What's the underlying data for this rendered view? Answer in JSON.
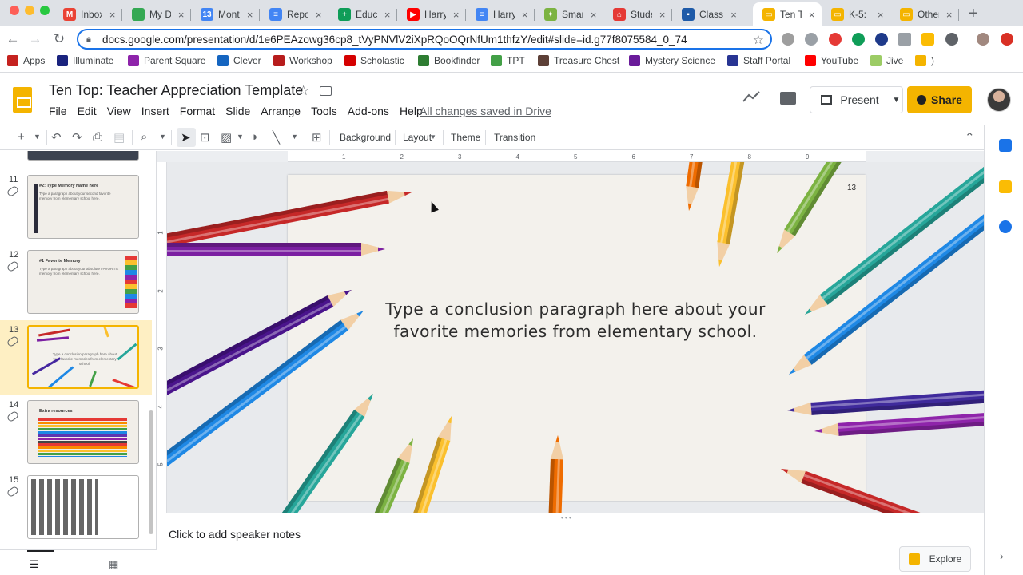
{
  "browser": {
    "tabs": [
      {
        "title": "Inbox",
        "favicon": "gmail-icon",
        "color": "#ea4335",
        "letter": "M"
      },
      {
        "title": "My Dr",
        "favicon": "drive-icon",
        "color": "#34a853",
        "letter": ""
      },
      {
        "title": "Monte",
        "favicon": "calendar-icon",
        "color": "#4285f4",
        "letter": "13"
      },
      {
        "title": "Repor",
        "favicon": "docs-icon",
        "color": "#4285f4",
        "letter": "≡"
      },
      {
        "title": "Educa",
        "favicon": "plus-icon",
        "color": "#0f9d58",
        "letter": "+"
      },
      {
        "title": "Harry",
        "favicon": "youtube-icon",
        "color": "#ff0000",
        "letter": "▶"
      },
      {
        "title": "Harry",
        "favicon": "docs-icon",
        "color": "#4285f4",
        "letter": "≡"
      },
      {
        "title": "Smar",
        "favicon": "smartboard-icon",
        "color": "#7cb342",
        "letter": "✦"
      },
      {
        "title": "Stude",
        "favicon": "home-icon",
        "color": "#e53935",
        "letter": "⌂"
      },
      {
        "title": "Class",
        "favicon": "classroom-icon",
        "color": "#1e5aa8",
        "letter": "▪"
      },
      {
        "title": "Ten T",
        "favicon": "slides-icon",
        "color": "#f4b400",
        "letter": "▭"
      },
      {
        "title": "K-5:",
        "favicon": "slides-icon",
        "color": "#f4b400",
        "letter": "▭"
      },
      {
        "title": "Other",
        "favicon": "slides-icon",
        "color": "#f4b400",
        "letter": "▭"
      }
    ],
    "active_tab_index": 10,
    "url": "docs.google.com/presentation/d/1e6PEAzowg36cp8_tVyPNVlV2iXpRQoOQrNfUm1thfzY/edit#slide=id.g77f8075584_0_74",
    "bookmarks": [
      {
        "label": "Apps",
        "icon": "apps-grid-icon",
        "color": "#c5221f"
      },
      {
        "label": "Illuminate",
        "icon": "illuminate-icon",
        "color": "#1a237e"
      },
      {
        "label": "Parent Square",
        "icon": "parentsquare-icon",
        "color": "#8e24aa"
      },
      {
        "label": "Clever",
        "icon": "clever-icon",
        "color": "#1565c0"
      },
      {
        "label": "Workshop",
        "icon": "workshop-icon",
        "color": "#b71c1c"
      },
      {
        "label": "Scholastic",
        "icon": "scholastic-icon",
        "color": "#d50000"
      },
      {
        "label": "Bookfinder",
        "icon": "bookfinder-icon",
        "color": "#2e7d32"
      },
      {
        "label": "TPT",
        "icon": "tpt-icon",
        "color": "#43a047"
      },
      {
        "label": "Treasure Chest",
        "icon": "treasure-icon",
        "color": "#5d4037"
      },
      {
        "label": "Mystery Science",
        "icon": "mystery-icon",
        "color": "#6a1b9a"
      },
      {
        "label": "Staff Portal",
        "icon": "portal-icon",
        "color": "#283593"
      },
      {
        "label": "YouTube",
        "icon": "youtube-icon",
        "color": "#ff0000"
      },
      {
        "label": "Jive",
        "icon": "jive-icon",
        "color": "#9ccc65"
      },
      {
        "label": ")",
        "icon": "slides-icon",
        "color": "#f4b400"
      }
    ]
  },
  "app": {
    "title": "Ten Top: Teacher Appreciation Template",
    "menu": [
      "File",
      "Edit",
      "View",
      "Insert",
      "Format",
      "Slide",
      "Arrange",
      "Tools",
      "Add-ons",
      "Help"
    ],
    "save_status": "All changes saved in Drive",
    "present_label": "Present",
    "share_label": "Share",
    "accent": "#f4b400"
  },
  "toolbar": {
    "background": "Background",
    "layout": "Layout",
    "theme": "Theme",
    "transition": "Transition"
  },
  "ruler": {
    "h_ticks": [
      "1",
      "2",
      "3",
      "4",
      "5",
      "6",
      "7",
      "8",
      "9"
    ],
    "v_ticks": [
      "1",
      "2",
      "3",
      "4",
      "5"
    ]
  },
  "filmstrip": [
    {
      "num": "11",
      "heading": "#2: Type Memory Name here",
      "body": "Type a paragraph about your second favorite memory from elementary school here."
    },
    {
      "num": "12",
      "heading": "#1 Favorite Memory",
      "body": "Type a paragraph about your absolute FAVORITE memory from elementary school here."
    },
    {
      "num": "13",
      "heading": "",
      "body": "Type a conclusion paragraph here about your favorite memories from elementary school."
    },
    {
      "num": "14",
      "heading": "Extra resources",
      "body": ""
    },
    {
      "num": "15",
      "heading": "",
      "body": ""
    }
  ],
  "selected_slide": "13",
  "slide": {
    "number": "13",
    "text": "Type a conclusion paragraph here about your favorite memories from elementary school."
  },
  "notes": {
    "placeholder": "Click to add speaker notes"
  },
  "explore_label": "Explore"
}
